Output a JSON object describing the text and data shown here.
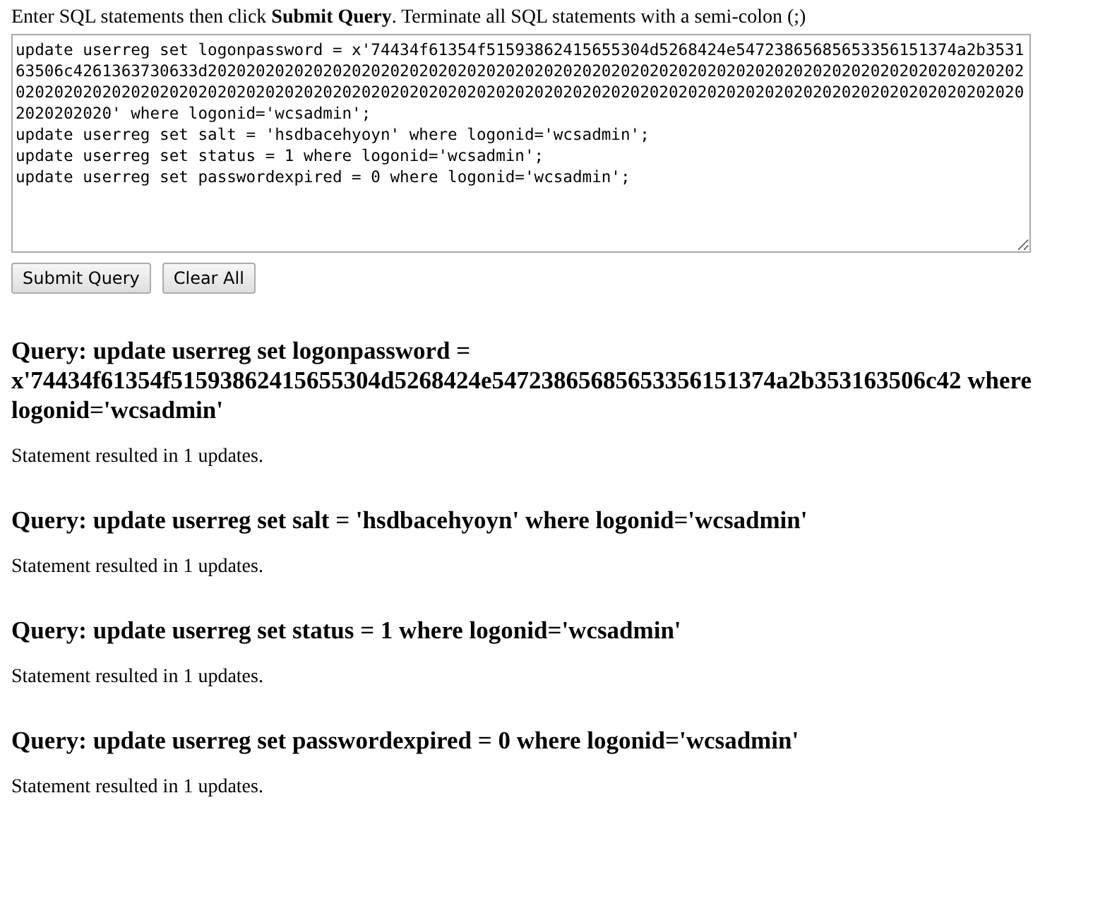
{
  "instructions": "Enter SQL statements then click **Submit Query**. Terminate all SQL statements with a semi-colon (;)",
  "sql_input": {
    "lines": [
      "update userreg set logonpassword = x'74434f61354f51593862415655304d5268424e54723865685653356151374a2b353163506c4261363730633d20202020202020202020202020202020202020202020202020202020202020202020202020202020202020202020202020202020202020202020202020202020202020202020202020202020202020202020202020202020202020202020202020202020' where logonid='wcsadmin';",
      "update userreg set salt = 'hsdbacehyoyn' where logonid='wcsadmin';",
      "update userreg set status = 1 where logonid='wcsadmin';",
      "update userreg set passwordexpired = 0 where logonid='wcsadmin';"
    ]
  },
  "buttons": [
    "Submit Query",
    "Clear All"
  ],
  "results": [
    {
      "query": "Query: update userreg set logonpassword = x'74434f61354f51593862415655304d5268424e54723865685653356151374a2b353163506c42 where logonid='wcsadmin'",
      "message": "Statement resulted in 1 updates."
    },
    {
      "query": "Query: update userreg set salt = 'hsdbacehyoyn' where logonid='wcsadmin'",
      "message": "Statement resulted in 1 updates."
    },
    {
      "query": "Query: update userreg set status = 1 where logonid='wcsadmin'",
      "message": "Statement resulted in 1 updates."
    },
    {
      "query": "Query: update userreg set passwordexpired = 0 where logonid='wcsadmin'",
      "message": "Statement resulted in 1 updates."
    }
  ]
}
